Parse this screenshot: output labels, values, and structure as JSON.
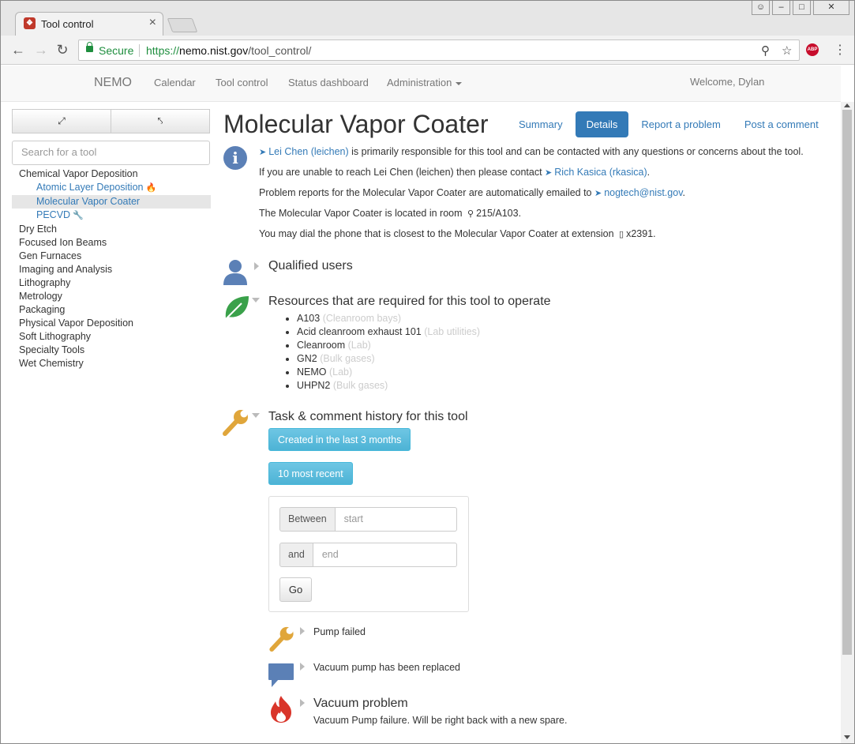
{
  "browser": {
    "tab_title": "Tool control",
    "secure_label": "Secure",
    "url_scheme": "https://",
    "url_host": "nemo.nist.gov",
    "url_path": "/tool_control/",
    "extension_label": "ABP"
  },
  "navbar": {
    "brand": "NEMO",
    "links": [
      "Calendar",
      "Tool control",
      "Status dashboard",
      "Administration"
    ],
    "welcome": "Welcome, Dylan"
  },
  "sidebar": {
    "search_placeholder": "Search for a tool",
    "categories": [
      {
        "label": "Chemical Vapor Deposition",
        "tools": [
          {
            "label": "Atomic Layer Deposition",
            "status": "problem"
          },
          {
            "label": "Molecular Vapor Coater",
            "status": "selected"
          },
          {
            "label": "PECVD",
            "status": "maintenance"
          }
        ]
      },
      {
        "label": "Dry Etch"
      },
      {
        "label": "Focused Ion Beams"
      },
      {
        "label": "Gen Furnaces"
      },
      {
        "label": "Imaging and Analysis"
      },
      {
        "label": "Lithography"
      },
      {
        "label": "Metrology"
      },
      {
        "label": "Packaging"
      },
      {
        "label": "Physical Vapor Deposition"
      },
      {
        "label": "Soft Lithography"
      },
      {
        "label": "Specialty Tools"
      },
      {
        "label": "Wet Chemistry"
      }
    ]
  },
  "tool": {
    "name": "Molecular Vapor Coater",
    "tabs": [
      "Summary",
      "Details",
      "Report a problem",
      "Post a comment"
    ],
    "active_tab": "Details",
    "info": {
      "primary_contact": "Lei Chen (leichen)",
      "line1_rest": " is primarily responsible for this tool and can be contacted with any questions or concerns about the tool.",
      "line2_pre": "If you are unable to reach Lei Chen (leichen) then please contact ",
      "backup_contact": "Rich Kasica (rkasica)",
      "line2_post": ".",
      "line3_pre": "Problem reports for the Molecular Vapor Coater are automatically emailed to ",
      "email": "nogtech@nist.gov",
      "line3_post": ".",
      "line4_pre": "The Molecular Vapor Coater is located in room ",
      "room": "215/A103",
      "line4_post": ".",
      "line5_pre": "You may dial the phone that is closest to the Molecular Vapor Coater at extension ",
      "extension": "x2391",
      "line5_post": "."
    },
    "qualified_users_title": "Qualified users",
    "resources_title": "Resources that are required for this tool to operate",
    "resources": [
      {
        "name": "A103",
        "category": "(Cleanroom bays)"
      },
      {
        "name": "Acid cleanroom exhaust 101",
        "category": "(Lab utilities)"
      },
      {
        "name": "Cleanroom",
        "category": "(Lab)"
      },
      {
        "name": "GN2",
        "category": "(Bulk gases)"
      },
      {
        "name": "NEMO",
        "category": "(Lab)"
      },
      {
        "name": "UHPN2",
        "category": "(Bulk gases)"
      }
    ],
    "history_title": "Task & comment history for this tool",
    "history_buttons": [
      "Created in the last 3 months",
      "10 most recent"
    ],
    "date_filter": {
      "between_label": "Between",
      "start_placeholder": "start",
      "and_label": "and",
      "end_placeholder": "end",
      "go_label": "Go"
    },
    "history": [
      {
        "type": "task",
        "text": "Pump failed"
      },
      {
        "type": "comment",
        "text": "Vacuum pump has been replaced"
      },
      {
        "type": "problem",
        "title": "Vacuum problem",
        "text": "Vacuum Pump failure. Will be right back with a new spare."
      }
    ]
  },
  "colors": {
    "link": "#337ab7",
    "info_button": "#5bc0de",
    "wrench": "#e0a63b",
    "leaf": "#3aa14a",
    "problem": "#d9352a",
    "user_icon": "#5b80b6"
  }
}
